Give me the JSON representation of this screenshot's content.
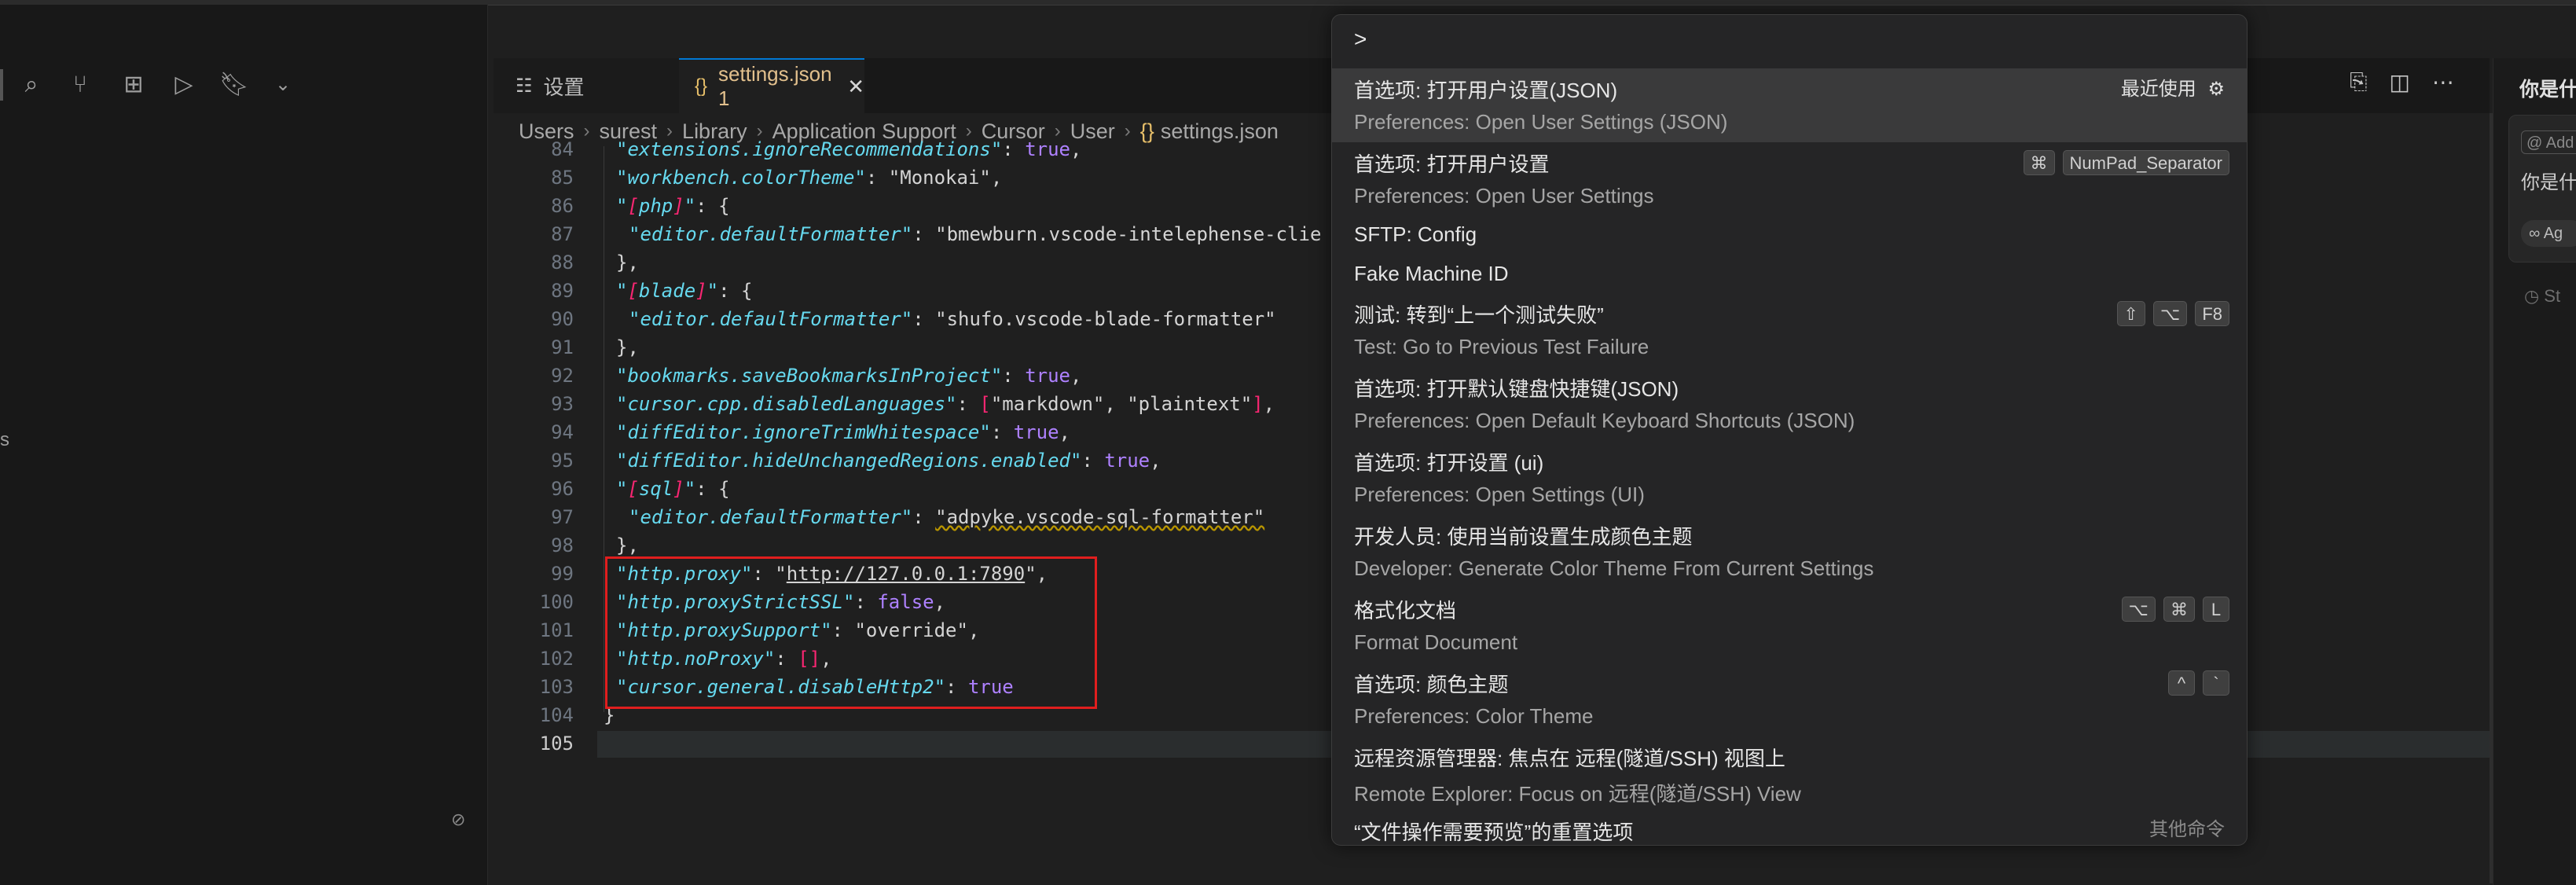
{
  "tabs": [
    {
      "label": "设置",
      "icon": "settings-list-icon"
    },
    {
      "label": "settings.json 1",
      "icon": "json-braces-icon"
    }
  ],
  "breadcrumb": [
    "Users",
    "surest",
    "Library",
    "Application Support",
    "Cursor",
    "User",
    "settings.json"
  ],
  "editor": {
    "line_numbers": [
      "84",
      "85",
      "86",
      "87",
      "88",
      "89",
      "90",
      "91",
      "92",
      "93",
      "94",
      "95",
      "96",
      "97",
      "98",
      "99",
      "100",
      "101",
      "102",
      "103",
      "104",
      "105"
    ],
    "lines": [
      "\"extensions.ignoreRecommendations\": true,",
      "\"workbench.colorTheme\": \"Monokai\",",
      "\"[php]\": {",
      "\"editor.defaultFormatter\": \"bmewburn.vscode-intelephense-clie",
      "},",
      "\"[blade]\": {",
      "\"editor.defaultFormatter\": \"shufo.vscode-blade-formatter\"",
      "},",
      "\"bookmarks.saveBookmarksInProject\": true,",
      "\"cursor.cpp.disabledLanguages\": [\"markdown\", \"plaintext\"],",
      "\"diffEditor.ignoreTrimWhitespace\": true,",
      "\"diffEditor.hideUnchangedRegions.enabled\": true,",
      "\"[sql]\": {",
      "\"editor.defaultFormatter\": \"adpyke.vscode-sql-formatter\"",
      "},",
      "\"http.proxy\": \"http://127.0.0.1:7890\",",
      "\"http.proxyStrictSSL\": false,",
      "\"http.proxySupport\": \"override\",",
      "\"http.noProxy\": [],",
      "\"cursor.general.disableHttp2\": true",
      "}",
      ""
    ]
  },
  "palette": {
    "input_value": ">",
    "recent_label": "最近使用",
    "other_commands_label": "其他命令",
    "items": [
      {
        "title": "首选项: 打开用户设置(JSON)",
        "sub": "Preferences: Open User Settings (JSON)",
        "keys": []
      },
      {
        "title": "首选项: 打开用户设置",
        "sub": "Preferences: Open User Settings",
        "keys": [
          "⌘",
          "NumPad_Separator"
        ]
      },
      {
        "title": "SFTP: Config",
        "sub": "",
        "keys": []
      },
      {
        "title": "Fake Machine ID",
        "sub": "",
        "keys": []
      },
      {
        "title": "测试: 转到“上一个测试失败”",
        "sub": "Test: Go to Previous Test Failure",
        "keys": [
          "⇧",
          "⌥",
          "F8"
        ]
      },
      {
        "title": "首选项: 打开默认键盘快捷键(JSON)",
        "sub": "Preferences: Open Default Keyboard Shortcuts (JSON)",
        "keys": []
      },
      {
        "title": "首选项: 打开设置 (ui)",
        "sub": "Preferences: Open Settings (UI)",
        "keys": []
      },
      {
        "title": "开发人员: 使用当前设置生成颜色主题",
        "sub": "Developer: Generate Color Theme From Current Settings",
        "keys": []
      },
      {
        "title": "格式化文档",
        "sub": "Format Document",
        "keys": [
          "⌥",
          "⌘",
          "L"
        ]
      },
      {
        "title": "首选项: 颜色主题",
        "sub": "Preferences: Color Theme",
        "keys": [
          "^",
          "`"
        ]
      },
      {
        "title": "远程资源管理器: 焦点在 远程(隧道/SSH) 视图上",
        "sub": "Remote Explorer: Focus on 远程(隧道/SSH) View",
        "keys": []
      },
      {
        "title": "“文件操作需要预览”的重置选项",
        "sub": "",
        "keys": []
      }
    ]
  },
  "chat": {
    "title": "你是什",
    "input_placeholder": "@ Add",
    "text": "你是什",
    "agent_label": "∞ Ag",
    "start_label": "◷ St"
  },
  "left": {
    "letter": "s",
    "slash": "⊘"
  }
}
